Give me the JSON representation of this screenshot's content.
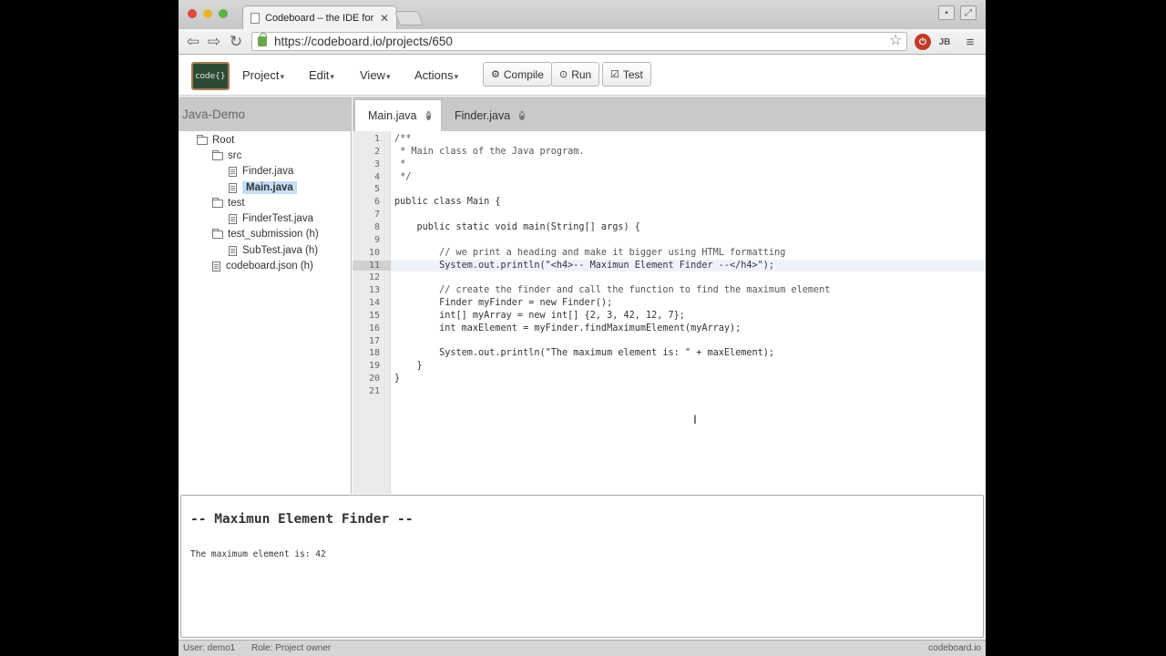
{
  "browser": {
    "tab_title": "Codeboard – the IDE for th",
    "url": "https://codeboard.io/projects/650",
    "ext_label": "JB"
  },
  "toolbar": {
    "logo_text": "code{}",
    "menus": [
      "Project",
      "Edit",
      "View",
      "Actions"
    ],
    "compile_label": "Compile",
    "run_label": "Run",
    "test_label": "Test"
  },
  "sidebar": {
    "project_name": "Java-Demo",
    "tree": [
      {
        "label": "Root",
        "type": "folder"
      },
      {
        "label": "src",
        "type": "folder"
      },
      {
        "label": "Finder.java",
        "type": "file"
      },
      {
        "label": "Main.java",
        "type": "file",
        "selected": true
      },
      {
        "label": "test",
        "type": "folder"
      },
      {
        "label": "FinderTest.java",
        "type": "file"
      },
      {
        "label": "test_submission (h)",
        "type": "folder"
      },
      {
        "label": "SubTest.java (h)",
        "type": "file"
      },
      {
        "label": "codeboard.json (h)",
        "type": "file"
      }
    ]
  },
  "editor": {
    "tabs": [
      {
        "label": "Main.java",
        "active": true
      },
      {
        "label": "Finder.java",
        "active": false
      }
    ],
    "active_line": 11,
    "lines": [
      "/**",
      " * Main class of the Java program.",
      " *",
      " */",
      "",
      "public class Main {",
      "",
      "    public static void main(String[] args) {",
      "",
      "        // we print a heading and make it bigger using HTML formatting",
      "        System.out.println(\"<h4>-- Maximun Element Finder --</h4>\");",
      "",
      "        // create the finder and call the function to find the maximum element",
      "        Finder myFinder = new Finder();",
      "        int[] myArray = new int[] {2, 3, 42, 12, 7};",
      "        int maxElement = myFinder.findMaximumElement(myArray);",
      "",
      "        System.out.println(\"The maximum element is: \" + maxElement);",
      "    }",
      "}",
      ""
    ]
  },
  "output": {
    "heading": "-- Maximun Element Finder --",
    "line": "The maximum element is: 42"
  },
  "status": {
    "user": "User: demo1",
    "role": "Role: Project owner",
    "brand": "codeboard.io"
  }
}
